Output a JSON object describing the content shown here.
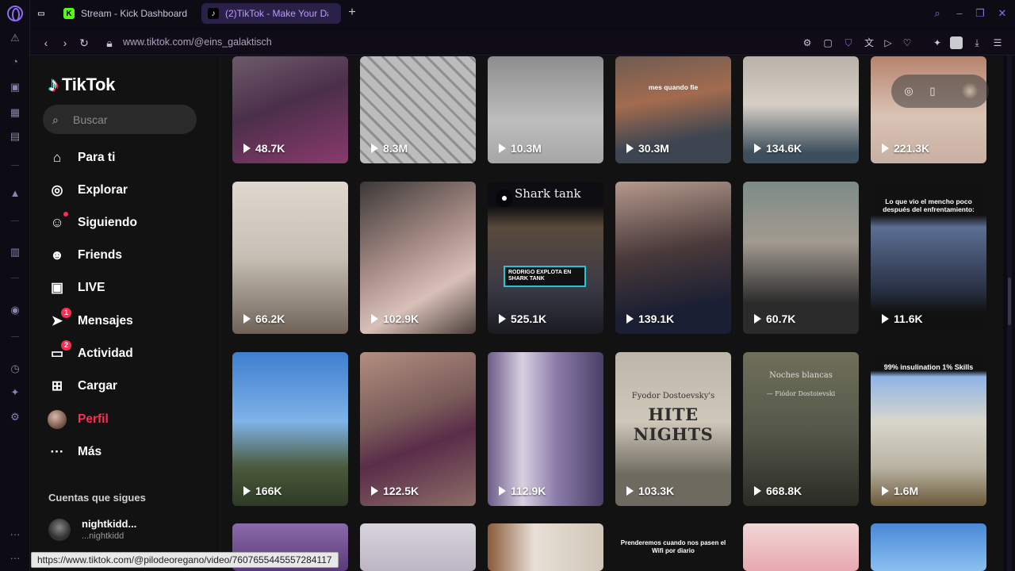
{
  "browser": {
    "tabs": [
      {
        "label": "Stream - Kick Dashboard",
        "favicon_color": "#53fc18"
      },
      {
        "label": "(2)TikTok - Make Your Da",
        "favicon_color": "#fe2c55"
      }
    ],
    "url": "www.tiktok.com/@eins_galaktisch",
    "hover_url": "https://www.tiktok.com/@pilodeoregano/video/7607655445557284117",
    "accent": "#8d6cf0"
  },
  "tiktok": {
    "logo_text": "TikTok",
    "search": {
      "placeholder": "Buscar"
    },
    "nav": [
      {
        "label": "Para ti",
        "icon": "home-icon"
      },
      {
        "label": "Explorar",
        "icon": "compass-icon"
      },
      {
        "label": "Siguiendo",
        "icon": "following-icon"
      },
      {
        "label": "Friends",
        "icon": "friends-icon"
      },
      {
        "label": "LIVE",
        "icon": "live-icon"
      },
      {
        "label": "Mensajes",
        "icon": "messages-icon",
        "badge": "1"
      },
      {
        "label": "Actividad",
        "icon": "activity-icon",
        "badge": "2"
      },
      {
        "label": "Cargar",
        "icon": "upload-icon"
      },
      {
        "label": "Perfil",
        "icon": "profile-avatar"
      },
      {
        "label": "Más",
        "icon": "more-icon"
      }
    ],
    "following_title": "Cuentas que sigues",
    "following_accounts": [
      {
        "name": "nightkidd...",
        "handle": "...nightkidd"
      }
    ],
    "accent": "#fe2c55"
  },
  "videos": [
    {
      "views": "48.7K"
    },
    {
      "views": "8.3M"
    },
    {
      "views": "10.3M"
    },
    {
      "views": "30.3M",
      "overlay": "mes quando fie"
    },
    {
      "views": "134.6K"
    },
    {
      "views": "221.3K"
    },
    {
      "views": "66.2K"
    },
    {
      "views": "102.9K"
    },
    {
      "views": "525.1K",
      "overlay": "Shark tank",
      "caption": "RODRIGO EXPLOTA EN SHARK TANK"
    },
    {
      "views": "139.1K"
    },
    {
      "views": "60.7K"
    },
    {
      "views": "11.6K",
      "overlay": "Lo que vio el mencho poco después del enfrentamiento:"
    },
    {
      "views": "166K"
    },
    {
      "views": "122.5K"
    },
    {
      "views": "112.9K"
    },
    {
      "views": "103.3K",
      "overlay": "Fyodor Dostoevsky's",
      "caption": "HITE NIGHTS"
    },
    {
      "views": "668.8K",
      "overlay": "Noches blancas",
      "caption": "— Fiódor Dostoievski"
    },
    {
      "views": "1.6M",
      "overlay": "99% insulination 1% Skills"
    },
    {
      "views": ""
    },
    {
      "views": ""
    },
    {
      "views": ""
    },
    {
      "views": "",
      "overlay": "Prenderemos cuando nos pasen el Wifi por diario"
    },
    {
      "views": ""
    },
    {
      "views": ""
    }
  ]
}
